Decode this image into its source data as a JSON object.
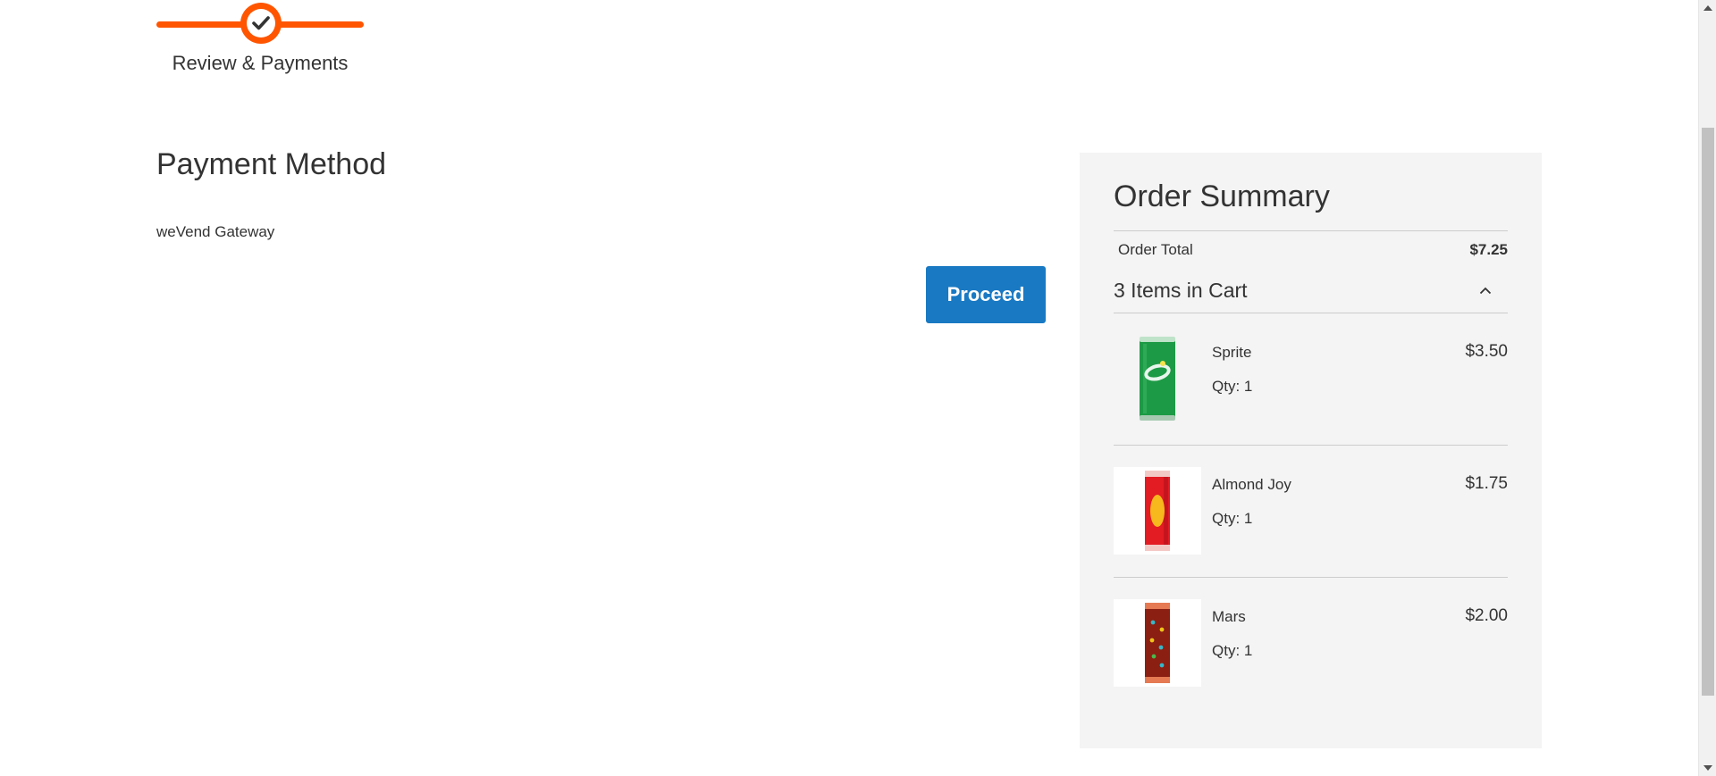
{
  "progress": {
    "step_label": "Review & Payments",
    "step_icon": "checkmark-icon",
    "accent_color": "#ff5501"
  },
  "payment": {
    "title": "Payment Method",
    "option_label": "weVend Gateway",
    "proceed_label": "Proceed",
    "button_color": "#1979c3"
  },
  "summary": {
    "title": "Order Summary",
    "total_label": "Order Total",
    "total_amount": "$7.25",
    "cart_count_label": "3 Items in Cart",
    "toggle_icon": "chevron-up-icon",
    "items": [
      {
        "name": "Sprite",
        "qty": "Qty: 1",
        "price": "$3.50",
        "thumb_icon": "sprite-can-icon"
      },
      {
        "name": "Almond Joy",
        "qty": "Qty: 1",
        "price": "$1.75",
        "thumb_icon": "almond-joy-bar-icon"
      },
      {
        "name": "Mars",
        "qty": "Qty: 1",
        "price": "$2.00",
        "thumb_icon": "mars-bar-icon"
      }
    ]
  }
}
